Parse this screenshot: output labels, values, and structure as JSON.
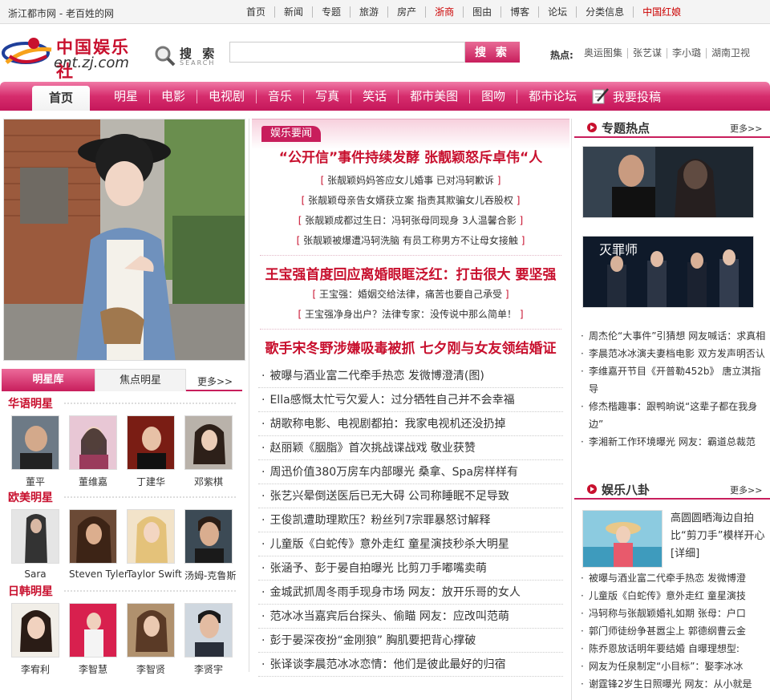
{
  "topbar": {
    "site_tag": "浙江都市网 - 老百姓的网",
    "links": [
      "首页",
      "新闻",
      "专题",
      "旅游",
      "房产",
      "浙商",
      "图由",
      "博客",
      "论坛",
      "分类信息",
      "中国红娘"
    ]
  },
  "header": {
    "logo_title": "中国娱乐社",
    "logo_url": "ent.zj.com",
    "search_label": "搜 索",
    "search_sub": "SEARCH",
    "search_value": "",
    "search_button": "搜 索",
    "hot_label": "热点:",
    "hot_links": [
      "奥运图集",
      "张艺谋",
      "李小璐",
      "湖南卫视"
    ]
  },
  "nav": {
    "home": "首页",
    "links": [
      "明星",
      "电影",
      "电视剧",
      "音乐",
      "写真",
      "笑话",
      "都市美图",
      "图吻",
      "都市论坛"
    ],
    "submit": "我要投稿"
  },
  "left": {
    "tab_active": "明星库",
    "tab_other": "焦点明星",
    "more": "更多>>",
    "categories": [
      {
        "title": "华语明星",
        "stars": [
          "董平",
          "董维嘉",
          "丁建华",
          "邓紫棋"
        ]
      },
      {
        "title": "欧美明星",
        "stars": [
          "Sara",
          "Steven Tyler",
          "Taylor Swift",
          "汤姆-克鲁斯"
        ]
      },
      {
        "title": "日韩明星",
        "stars": [
          "李宥利",
          "李智慧",
          "李智贤",
          "李贤宇"
        ]
      }
    ]
  },
  "middle": {
    "tag": "娱乐要闻",
    "headline1": "“公开信”事件持续发酵 张靓颖怒斥卓伟“人",
    "subs1": [
      "张靓颖妈妈答应女儿婚事 已对冯轲歉诉",
      "张靓颖母亲告女婿获立案 指责其欺骗女儿吞股权",
      "张靓颖成都过生日：冯轲张母同现身 3人温馨合影",
      "张靓颖被爆遭冯轲洗脑 有员工称男方不让母女接触"
    ],
    "headline2": "王宝强首度回应离婚眼眶泛红：打击很大 要坚强",
    "subs2": [
      "王宝强：婚姻交给法律，痛苦也要自己承受",
      "王宝强净身出户？法律专家：没传说中那么简单！"
    ],
    "headline3": "歌手宋冬野涉嫌吸毒被抓 七夕刚与女友领结婚证",
    "list": [
      "被曝与酒业富二代牵手热恋 发微博澄清(图)",
      "Ella感慨太忙亏欠爱人：过分牺牲自己并不会幸福",
      "胡歌称电影、电视剧都拍：我家电视机还没扔掉",
      "赵丽颖《胭脂》首次挑战谍战戏 敬业获赞",
      "周迅价值380万房车内部曝光 桑拿、Spa房样样有",
      "张艺兴晕倒送医后已无大碍 公司称睡眠不足导致",
      "王俊凯遭助理欺压？粉丝列7宗罪暴怒讨解释",
      "儿童版《白蛇传》意外走红 童星演技秒杀大明星",
      "张涵予、彭于晏自拍曝光 比剪刀手嘟嘴卖萌",
      "金城武抓周冬雨手现身市场 网友：放开乐哥的女人",
      "范冰冰当嘉宾后台探头、偷瞄 网友：应改叫范萌",
      "彭于晏深夜扮“金刚狼” 胸肌要把背心撑破",
      "张译谈李晨范冰冰恋情：他们是彼此最好的归宿"
    ]
  },
  "right": {
    "topic_title": "专题热点",
    "topic_more": "更多>>",
    "poster_text": "灭罪师",
    "topic_list": [
      "周杰伦“大事件”引猜想 网友喊话：求真相",
      "李晨范冰冰演夫妻档电影 双方发声明否认",
      "李维嘉开节目《开普勒452b》 唐立淇指导",
      "修杰楷趣事：跟鸭晌说“这辈子都在我身边”",
      "李湘新工作环境曝光 网友：霸道总裁范"
    ],
    "gossip_title": "娱乐八卦",
    "gossip_more": "更多>>",
    "gossip_caption": "高圆圆晒海边自拍 比“剪刀手”模样开心[详细]",
    "gossip_list": [
      "被曝与酒业富二代牵手热恋 发微博澄",
      "儿童版《白蛇传》意外走红 童星演技",
      "冯轲称与张靓颖婚礼如期 张母：户口",
      "郭门师徒纷争甚嚣尘上 郭德纲曹云金",
      "陈乔恩放话明年要结婚 自曝理想型:",
      "网友为任泉制定“小目标”：娶李冰冰",
      "谢霆锋2岁生日照曝光 网友：从小就是"
    ]
  },
  "colors": {
    "brand": "#c8102e",
    "nav": "#d62d6d"
  }
}
